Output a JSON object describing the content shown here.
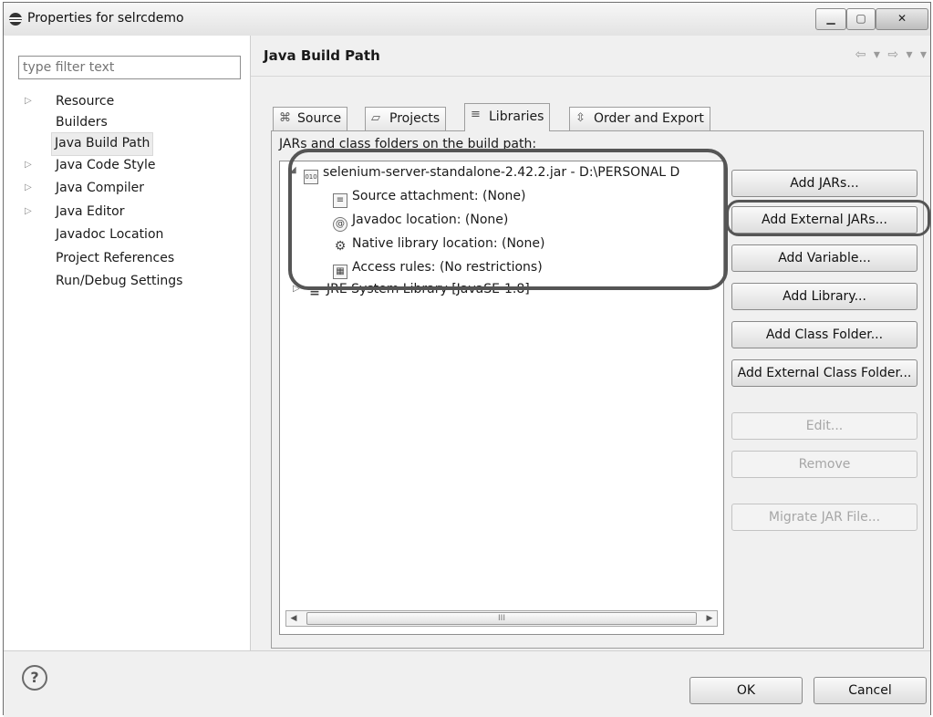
{
  "window": {
    "title": "Properties for selrcdemo",
    "min_symbol": "▁",
    "max_symbol": "▢",
    "close_symbol": "✕"
  },
  "filter": {
    "placeholder": "type filter text"
  },
  "nav": {
    "items": [
      {
        "label": "Resource",
        "expandable": true
      },
      {
        "label": "Builders",
        "expandable": false
      },
      {
        "label": "Java Build Path",
        "expandable": false,
        "selected": true
      },
      {
        "label": "Java Code Style",
        "expandable": true
      },
      {
        "label": "Java Compiler",
        "expandable": true
      },
      {
        "label": "Java Editor",
        "expandable": true
      },
      {
        "label": "Javadoc Location",
        "expandable": false
      },
      {
        "label": "Project References",
        "expandable": false
      },
      {
        "label": "Run/Debug Settings",
        "expandable": false
      }
    ]
  },
  "page": {
    "title": "Java Build Path",
    "history_nav": "⇦ ▾ ⇨ ▾ ▾"
  },
  "tabs": [
    {
      "label": "Source",
      "icon": "source-folder-icon",
      "glyph": "⌘",
      "active": false
    },
    {
      "label": "Projects",
      "icon": "folder-icon",
      "glyph": "▱",
      "active": false
    },
    {
      "label": "Libraries",
      "icon": "library-icon",
      "glyph": "≡",
      "active": true
    },
    {
      "label": "Order and Export",
      "icon": "order-icon",
      "glyph": "⇳",
      "active": false
    }
  ],
  "libraries": {
    "label": "JARs and class folders on the build path:",
    "tree": {
      "jar": {
        "label": "selenium-server-standalone-2.42.2.jar - D:\\PERSONAL D",
        "icon": "jar-icon",
        "glyph": "010"
      },
      "children": [
        {
          "label": "Source attachment: (None)",
          "icon": "source-attachment-icon",
          "glyph": "≡"
        },
        {
          "label": "Javadoc location: (None)",
          "icon": "javadoc-icon",
          "glyph": "@"
        },
        {
          "label": "Native library location: (None)",
          "icon": "native-library-icon",
          "glyph": "⚙"
        },
        {
          "label": "Access rules: (No restrictions)",
          "icon": "access-rules-icon",
          "glyph": "▦"
        }
      ],
      "jre": {
        "label": "JRE System Library [JavaSE-1.8]",
        "icon": "library-icon",
        "glyph": "≡"
      }
    },
    "scroll": {
      "left": "◀",
      "right": "▶",
      "grip": "III"
    },
    "buttons": {
      "add_jars": "Add JARs...",
      "add_external_jars": "Add External JARs...",
      "add_variable": "Add Variable...",
      "add_library": "Add Library...",
      "add_class_folder": "Add Class Folder...",
      "add_external_class_folder": "Add External Class Folder...",
      "edit": "Edit...",
      "remove": "Remove",
      "migrate": "Migrate JAR File..."
    }
  },
  "footer": {
    "help_glyph": "?",
    "ok": "OK",
    "cancel": "Cancel"
  }
}
